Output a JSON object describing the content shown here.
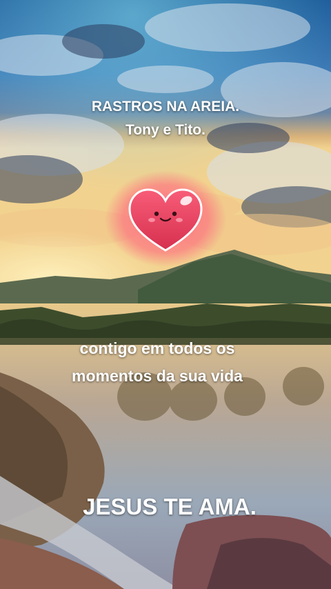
{
  "header": {
    "title": "RASTROS NA AREIA.",
    "subtitle": "Tony e Tito."
  },
  "message": {
    "line1": "contigo em todos os",
    "line2": "momentos da sua vida"
  },
  "footer": {
    "closing": "JESUS TE AMA."
  },
  "icons": {
    "sticker": "smiling-heart-icon"
  },
  "colors": {
    "text": "#ffffff",
    "heart": "#e8415f",
    "sky": "#2a6fb0",
    "sunset": "#f2c46b"
  }
}
